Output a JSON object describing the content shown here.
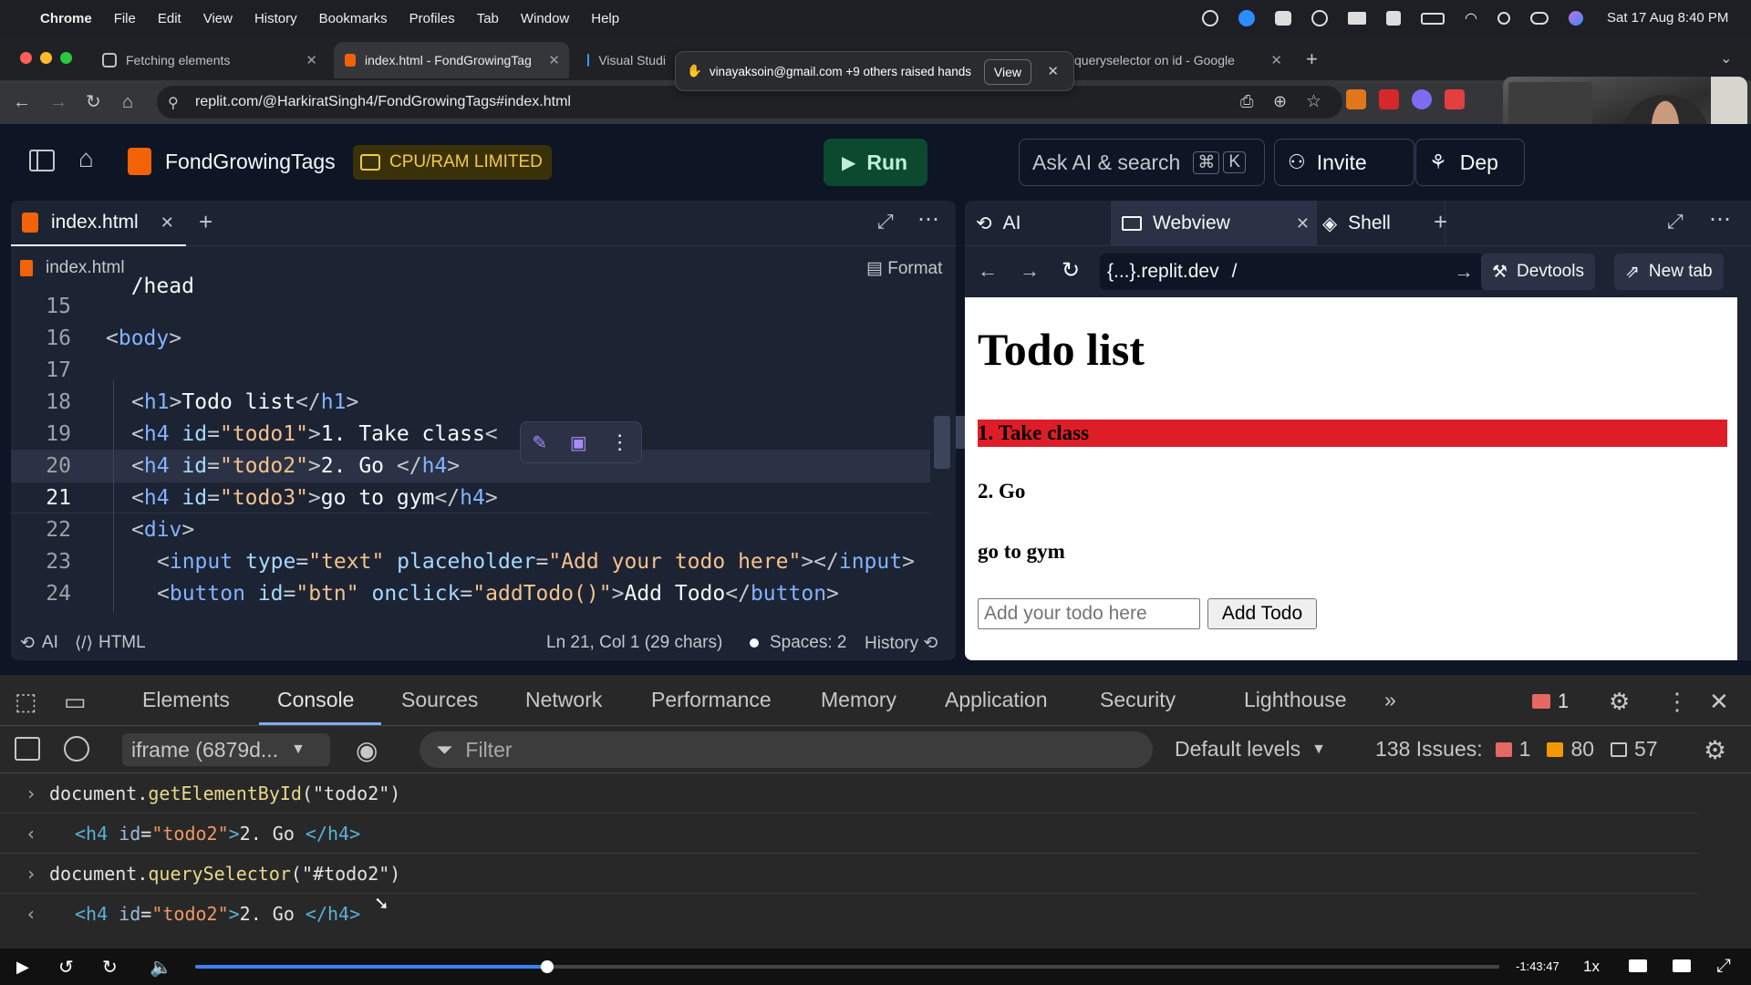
{
  "menubar": {
    "app": "Chrome",
    "items": [
      "File",
      "Edit",
      "View",
      "History",
      "Bookmarks",
      "Profiles",
      "Tab",
      "Window",
      "Help"
    ],
    "datetime": "Sat 17 Aug  8:40 PM"
  },
  "chrome_tabs": [
    {
      "title": "Fetching elements"
    },
    {
      "title": "index.html - FondGrowingTag"
    },
    {
      "title": "Visual Studi"
    },
    {
      "title": "queryselector on id - Google"
    }
  ],
  "notification": {
    "text": "vinayaksoin@gmail.com +9 others raised hands",
    "view_label": "View"
  },
  "address_bar": {
    "url": "replit.com/@HarkiratSingh4/FondGrowingTags#index.html"
  },
  "replit_header": {
    "project_name": "FondGrowingTags",
    "limit_badge": "CPU/RAM LIMITED",
    "run_label": "Run",
    "search_label": "Ask AI & search",
    "search_shortcut_cmd": "⌘",
    "search_shortcut_key": "K",
    "invite_label": "Invite",
    "deploy_label": "Dep"
  },
  "editor": {
    "tab_label": "index.html",
    "breadcrumb": "index.html",
    "format_label": "Format",
    "lines": [
      {
        "num": "15"
      },
      {
        "num": "16"
      },
      {
        "num": "17"
      },
      {
        "num": "18"
      },
      {
        "num": "19"
      },
      {
        "num": "20"
      },
      {
        "num": "21"
      },
      {
        "num": "22"
      },
      {
        "num": "23"
      },
      {
        "num": "24"
      }
    ],
    "status": {
      "ai": "AI",
      "lang": "HTML",
      "position": "Ln 21, Col 1 (29 chars)",
      "spaces": "Spaces: 2",
      "history": "History"
    }
  },
  "right_panel": {
    "tabs": [
      {
        "label": "AI"
      },
      {
        "label": "Webview"
      },
      {
        "label": "Shell"
      }
    ],
    "webview_domain": "{...}.replit.dev",
    "webview_path": "/",
    "devtools_label": "Devtools",
    "newtab_label": "New tab"
  },
  "webpage": {
    "heading": "Todo list",
    "todos": [
      "1. Take class",
      "2. Go",
      "go to gym"
    ],
    "input_placeholder": "Add your todo here",
    "button_label": "Add Todo"
  },
  "devtools": {
    "tabs": [
      "Elements",
      "Console",
      "Sources",
      "Network",
      "Performance",
      "Memory",
      "Application",
      "Security",
      "Lighthouse"
    ],
    "active_tab": "Console",
    "error_count": "1",
    "context": "iframe (6879d...",
    "filter_placeholder": "Filter",
    "levels": "Default levels",
    "issues_label": "138 Issues:",
    "issues_errors": "1",
    "issues_warnings": "80",
    "issues_info": "57",
    "console": [
      {
        "kind": "input",
        "obj": "document",
        "method": "getElementById",
        "arg": "\"todo2\""
      },
      {
        "kind": "output",
        "tag": "h4",
        "attr": "id",
        "val": "\"todo2\"",
        "text": "2. Go "
      },
      {
        "kind": "input",
        "obj": "document",
        "method": "querySelector",
        "arg": "\"#todo2\""
      },
      {
        "kind": "output",
        "tag": "h4",
        "attr": "id",
        "val": "\"todo2\"",
        "text": "2. Go "
      }
    ]
  },
  "video": {
    "time_remaining": "-1:43:47",
    "speed": "1x",
    "progress": 0.27
  }
}
